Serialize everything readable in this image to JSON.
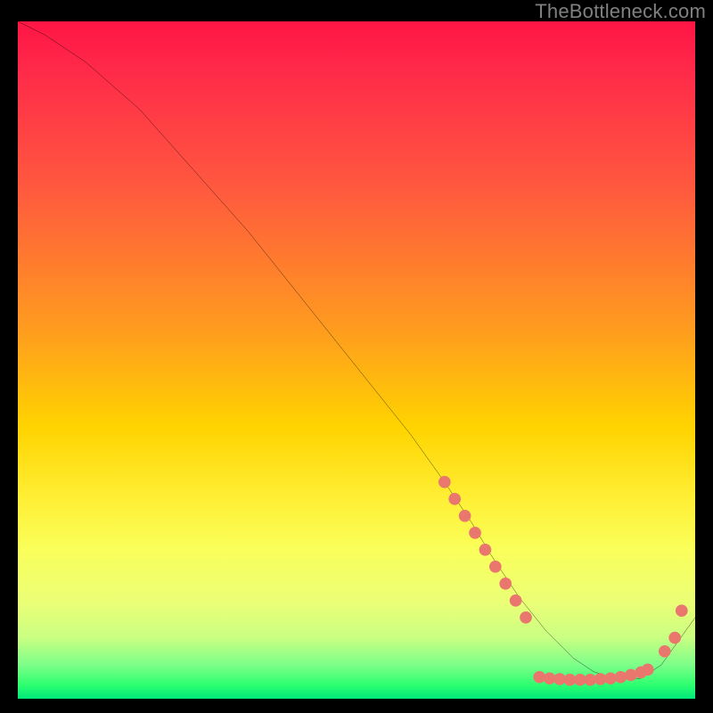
{
  "watermark": "TheBottleneck.com",
  "chart_data": {
    "type": "line",
    "title": "",
    "xlabel": "",
    "ylabel": "",
    "xlim": [
      0,
      100
    ],
    "ylim": [
      0,
      100
    ],
    "series": [
      {
        "name": "curve",
        "x": [
          0,
          4,
          10,
          18,
          26,
          34,
          42,
          50,
          58,
          63,
          67,
          70,
          74,
          78,
          82,
          85,
          88,
          92,
          95,
          100
        ],
        "y": [
          100,
          98,
          94,
          87,
          78,
          69,
          59,
          49,
          39,
          32,
          26,
          21,
          15,
          10,
          6,
          4,
          3,
          3,
          5,
          12
        ]
      }
    ],
    "markers": [
      {
        "x": 63.0,
        "y": 32.0
      },
      {
        "x": 64.5,
        "y": 29.5
      },
      {
        "x": 66.0,
        "y": 27.0
      },
      {
        "x": 67.5,
        "y": 24.5
      },
      {
        "x": 69.0,
        "y": 22.0
      },
      {
        "x": 70.5,
        "y": 19.5
      },
      {
        "x": 72.0,
        "y": 17.0
      },
      {
        "x": 73.5,
        "y": 14.5
      },
      {
        "x": 75.0,
        "y": 12.0
      },
      {
        "x": 77.0,
        "y": 3.2
      },
      {
        "x": 78.5,
        "y": 3.0
      },
      {
        "x": 80.0,
        "y": 2.9
      },
      {
        "x": 81.5,
        "y": 2.8
      },
      {
        "x": 83.0,
        "y": 2.8
      },
      {
        "x": 84.5,
        "y": 2.8
      },
      {
        "x": 86.0,
        "y": 2.9
      },
      {
        "x": 87.5,
        "y": 3.0
      },
      {
        "x": 89.0,
        "y": 3.2
      },
      {
        "x": 90.5,
        "y": 3.5
      },
      {
        "x": 92.0,
        "y": 3.9
      },
      {
        "x": 93.0,
        "y": 4.3
      },
      {
        "x": 95.5,
        "y": 7.0
      },
      {
        "x": 97.0,
        "y": 9.0
      },
      {
        "x": 98.0,
        "y": 13.0
      }
    ],
    "colors": {
      "line": "#000000",
      "marker": "#e9776e"
    }
  }
}
